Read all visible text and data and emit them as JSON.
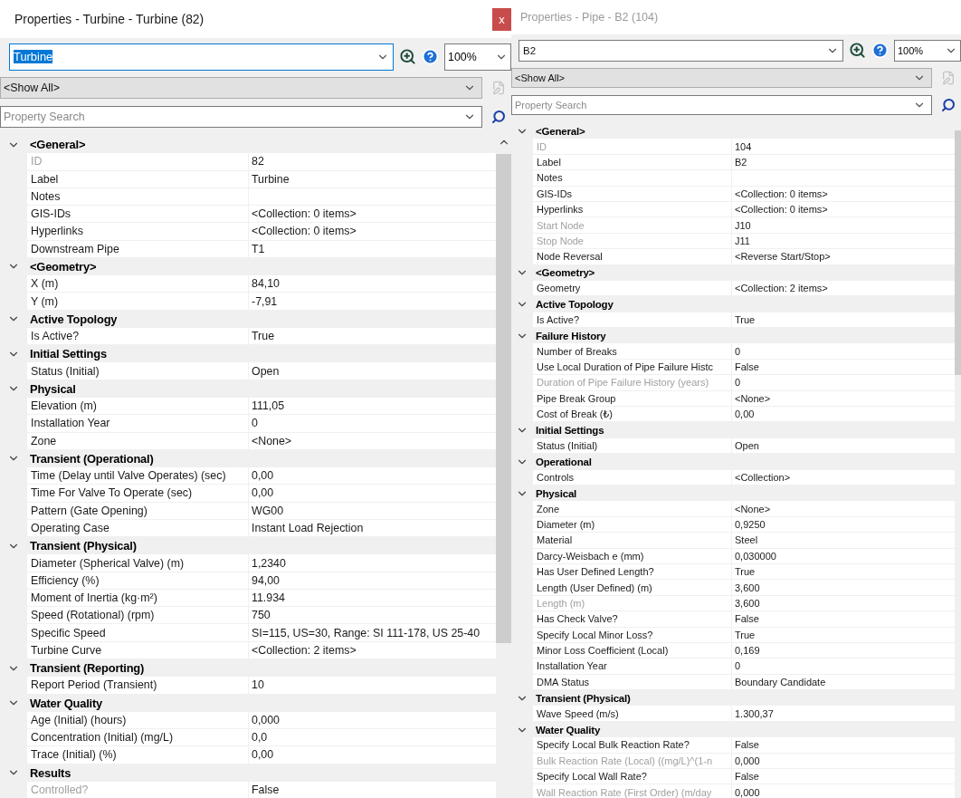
{
  "panels": [
    {
      "title": "Properties - Turbine - Turbine (82)",
      "active": true,
      "close": "x",
      "element": "Turbine",
      "zoom": "100%",
      "filter": "<Show All>",
      "search_placeholder": "Property Search",
      "sections": [
        {
          "name": "<General>",
          "expanded": true,
          "properties": [
            {
              "label": "ID",
              "value": "82",
              "disabled": true
            },
            {
              "label": "Label",
              "value": "Turbine",
              "disabled": false
            },
            {
              "label": "Notes",
              "disabled": false
            },
            {
              "label": "GIS-IDs",
              "value": "<Collection: 0 items>",
              "disabled": false
            },
            {
              "label": "Hyperlinks",
              "value": "<Collection: 0 items>",
              "disabled": false
            },
            {
              "label": "Downstream Pipe",
              "value": "T1",
              "disabled": false
            }
          ]
        },
        {
          "name": "<Geometry>",
          "expanded": true,
          "properties": [
            {
              "label": "X (m)",
              "value": "84,10",
              "disabled": false
            },
            {
              "label": "Y (m)",
              "value": "-7,91",
              "disabled": false
            }
          ]
        },
        {
          "name": "Active Topology",
          "expanded": true,
          "properties": [
            {
              "label": "Is Active?",
              "value": "True",
              "disabled": false
            }
          ]
        },
        {
          "name": "Initial Settings",
          "expanded": true,
          "properties": [
            {
              "label": "Status (Initial)",
              "value": "Open",
              "disabled": false
            }
          ]
        },
        {
          "name": "Physical",
          "expanded": true,
          "properties": [
            {
              "label": "Elevation (m)",
              "value": "111,05",
              "disabled": false
            },
            {
              "label": "Installation Year",
              "value": "0",
              "disabled": false
            },
            {
              "label": "Zone",
              "value": "<None>",
              "disabled": false
            }
          ]
        },
        {
          "name": "Transient (Operational)",
          "expanded": true,
          "properties": [
            {
              "label": "Time (Delay until Valve Operates) (sec)",
              "value": "0,00",
              "disabled": false
            },
            {
              "label": "Time For Valve To Operate (sec)",
              "value": "0,00",
              "disabled": false
            },
            {
              "label": "Pattern (Gate Opening)",
              "value": "WG00",
              "disabled": false
            },
            {
              "label": "Operating Case",
              "value": "Instant Load Rejection",
              "disabled": false
            }
          ]
        },
        {
          "name": "Transient (Physical)",
          "expanded": true,
          "properties": [
            {
              "label": "Diameter (Spherical Valve) (m)",
              "value": "1,2340",
              "disabled": false
            },
            {
              "label": "Efficiency (%)",
              "value": "94,00",
              "disabled": false
            },
            {
              "label": "Moment of Inertia (kg·m²)",
              "value": "11.934",
              "disabled": false
            },
            {
              "label": "Speed (Rotational) (rpm)",
              "value": "750",
              "disabled": false
            },
            {
              "label": "Specific Speed",
              "value": "SI=115, US=30, Range: SI 111-178, US 25-40",
              "disabled": false
            },
            {
              "label": "Turbine Curve",
              "value": "<Collection: 2 items>",
              "disabled": false
            }
          ]
        },
        {
          "name": "Transient (Reporting)",
          "expanded": true,
          "properties": [
            {
              "label": "Report Period (Transient)",
              "value": "10",
              "disabled": false
            }
          ]
        },
        {
          "name": "Water Quality",
          "expanded": true,
          "properties": [
            {
              "label": "Age (Initial) (hours)",
              "value": "0,000",
              "disabled": false
            },
            {
              "label": "Concentration (Initial) (mg/L)",
              "value": "0,0",
              "disabled": false
            },
            {
              "label": "Trace (Initial) (%)",
              "value": "0,00",
              "disabled": false
            }
          ]
        },
        {
          "name": "Results",
          "expanded": true,
          "properties": [
            {
              "label": "Controlled?",
              "value": "False",
              "disabled": true
            }
          ]
        }
      ]
    },
    {
      "title": "Properties - Pipe - B2 (104)",
      "active": false,
      "element": "B2",
      "zoom": "100%",
      "filter": "<Show All>",
      "search_placeholder": "Property Search",
      "sections": [
        {
          "name": "<General>",
          "expanded": true,
          "properties": [
            {
              "label": "ID",
              "value": "104",
              "disabled": true
            },
            {
              "label": "Label",
              "value": "B2",
              "disabled": false
            },
            {
              "label": "Notes",
              "disabled": false
            },
            {
              "label": "GIS-IDs",
              "value": "<Collection: 0 items>",
              "disabled": false
            },
            {
              "label": "Hyperlinks",
              "value": "<Collection: 0 items>",
              "disabled": false
            },
            {
              "label": "Start Node",
              "value": "J10",
              "disabled": true
            },
            {
              "label": "Stop Node",
              "value": "J11",
              "disabled": true
            },
            {
              "label": "Node Reversal",
              "value": "<Reverse Start/Stop>",
              "disabled": false
            }
          ]
        },
        {
          "name": "<Geometry>",
          "expanded": true,
          "properties": [
            {
              "label": "Geometry",
              "value": "<Collection: 2 items>",
              "disabled": false
            }
          ]
        },
        {
          "name": "Active Topology",
          "expanded": true,
          "properties": [
            {
              "label": "Is Active?",
              "value": "True",
              "disabled": false
            }
          ]
        },
        {
          "name": "Failure History",
          "expanded": true,
          "properties": [
            {
              "label": "Number of Breaks",
              "value": "0",
              "disabled": false
            },
            {
              "label": "Use Local Duration of Pipe Failure Histc",
              "value": "False",
              "disabled": false
            },
            {
              "label": "Duration of Pipe Failure History (years)",
              "value": "0",
              "disabled": true
            },
            {
              "label": "Pipe Break Group",
              "value": "<None>",
              "disabled": false
            },
            {
              "label": "Cost of Break (₺)",
              "value": "0,00",
              "disabled": false
            }
          ]
        },
        {
          "name": "Initial Settings",
          "expanded": true,
          "properties": [
            {
              "label": "Status (Initial)",
              "value": "Open",
              "disabled": false
            }
          ]
        },
        {
          "name": "Operational",
          "expanded": true,
          "properties": [
            {
              "label": "Controls",
              "value": "<Collection>",
              "disabled": false
            }
          ]
        },
        {
          "name": "Physical",
          "expanded": true,
          "properties": [
            {
              "label": "Zone",
              "value": "<None>",
              "disabled": false
            },
            {
              "label": "Diameter (m)",
              "value": "0,9250",
              "disabled": false
            },
            {
              "label": "Material",
              "value": "Steel",
              "disabled": false
            },
            {
              "label": "Darcy-Weisbach e (mm)",
              "value": "0,030000",
              "disabled": false
            },
            {
              "label": "Has User Defined Length?",
              "value": "True",
              "disabled": false
            },
            {
              "label": "Length (User Defined) (m)",
              "value": "3,600",
              "disabled": false
            },
            {
              "label": "Length (m)",
              "value": "3,600",
              "disabled": true
            },
            {
              "label": "Has Check Valve?",
              "value": "False",
              "disabled": false
            },
            {
              "label": "Specify Local Minor Loss?",
              "value": "True",
              "disabled": false
            },
            {
              "label": "Minor Loss Coefficient (Local)",
              "value": "0,169",
              "disabled": false
            },
            {
              "label": "Installation Year",
              "value": "0",
              "disabled": false
            },
            {
              "label": "DMA Status",
              "value": "Boundary Candidate",
              "disabled": false
            }
          ]
        },
        {
          "name": "Transient (Physical)",
          "expanded": true,
          "properties": [
            {
              "label": "Wave Speed (m/s)",
              "value": "1.300,37",
              "disabled": false
            }
          ]
        },
        {
          "name": "Water Quality",
          "expanded": true,
          "properties": [
            {
              "label": "Specify Local Bulk Reaction Rate?",
              "value": "False",
              "disabled": false
            },
            {
              "label": "Bulk Reaction Rate (Local) ((mg/L)^(1-n",
              "value": "0,000",
              "disabled": true
            },
            {
              "label": "Specify Local Wall Rate?",
              "value": "False",
              "disabled": false
            },
            {
              "label": "Wall Reaction Rate (First Order) (m/day",
              "value": "0,000",
              "disabled": true
            }
          ]
        }
      ]
    }
  ]
}
